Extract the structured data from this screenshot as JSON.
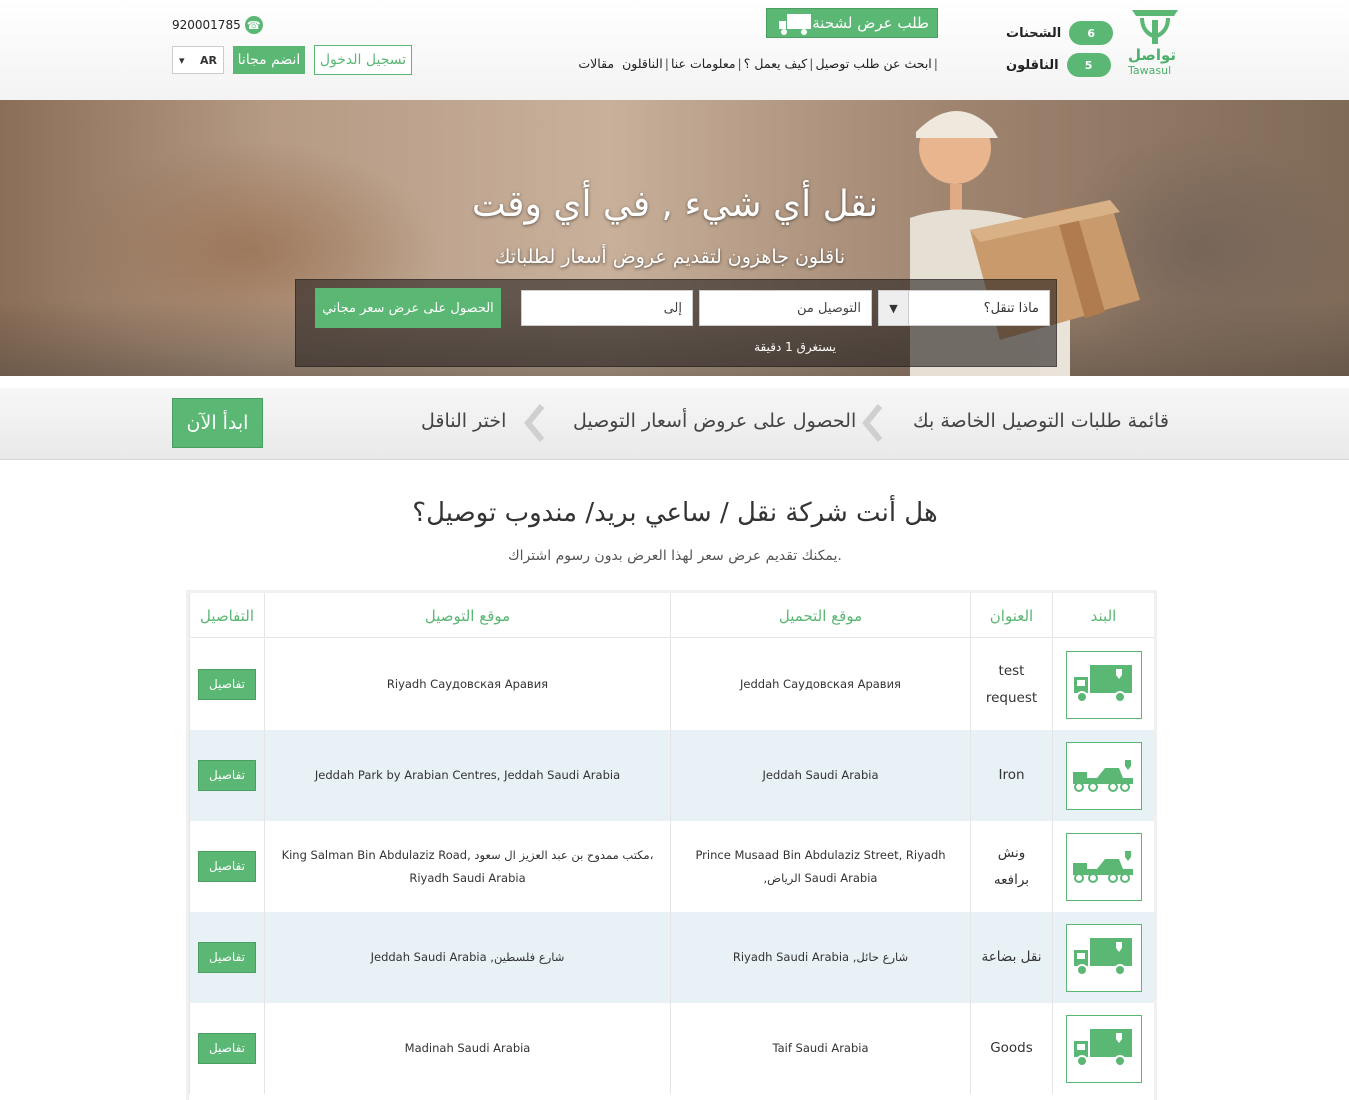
{
  "header": {
    "logo_ar": "تواصل",
    "logo_en": "Tawasul",
    "stats": [
      {
        "label": "الشحنات",
        "count": "6"
      },
      {
        "label": "الناقلون",
        "count": "5"
      }
    ],
    "post_shipment": "طلب عرض لشحنة",
    "nav": [
      "ابحث عن طلب توصيل",
      "كيف يعمل ؟",
      "معلومات عنا",
      "الناقلون",
      "مقالات"
    ],
    "phone": "920001785",
    "lang": "AR",
    "join": "انضم مجانا",
    "login": "تسجيل الدخول"
  },
  "hero": {
    "title": "نقل أي شيء , في أي وقت",
    "subtitle": "ناقلون جاهزون لتقديم عروض أسعار لطلباتك",
    "what_placeholder": "ماذا تنقل؟",
    "from_placeholder": "التوصيل من",
    "to_placeholder": "إلى",
    "cta": "الحصول على عرض سعر مجاني",
    "note": "يستغرق 1 دقيقة"
  },
  "steps": {
    "items": [
      "قائمة طلبات التوصيل الخاصة بك",
      "الحصول على عروض أسعار التوصيل",
      "اختر الناقل"
    ],
    "start": "ابدأ الآن"
  },
  "section": {
    "title": "هل أنت شركة نقل / ساعي بريد/ مندوب توصيل؟",
    "subtitle": ".يمكنك تقديم عرض سعر لهذا العرض بدون رسوم اشتراك"
  },
  "table": {
    "headers": {
      "item": "البند",
      "title": "العنوان",
      "pickup": "موقع التحميل",
      "delivery": "موقع التوصيل",
      "details": "التفاصيل"
    },
    "rows": [
      {
        "icon": "box-truck-icon",
        "title": "test request",
        "pickup": "Jeddah Саудовская Аравия",
        "delivery": "Riyadh Саудовская Аравия",
        "details": "تفاصيل"
      },
      {
        "icon": "tow-truck-icon",
        "title": "Iron",
        "pickup": "Jeddah Saudi Arabia",
        "delivery": "Jeddah Park by Arabian Centres, Jeddah Saudi Arabia",
        "details": "تفاصيل"
      },
      {
        "icon": "tow-truck-icon",
        "title": "ونش برافعه",
        "pickup": "Prince Musaad Bin Abdulaziz Street, Riyadh ,الرياض Saudi Arabia",
        "delivery": "King Salman Bin Abdulaziz Road, مكتب ممدوح بن عبد العزيز ال سعود، Riyadh Saudi Arabia",
        "details": "تفاصيل"
      },
      {
        "icon": "box-truck-icon",
        "title": "نقل بضاعة",
        "pickup": "Riyadh Saudi Arabia ,شارع حائل",
        "delivery": "Jeddah Saudi Arabia ,شارع فلسطين",
        "details": "تفاصيل"
      },
      {
        "icon": "box-truck-icon",
        "title": "Goods",
        "pickup": "Taif Saudi Arabia",
        "delivery": "Madinah Saudi Arabia",
        "details": "تفاصيل"
      }
    ]
  },
  "colors": {
    "accent": "#5bb774",
    "row_alt": "#e8f1f6"
  }
}
